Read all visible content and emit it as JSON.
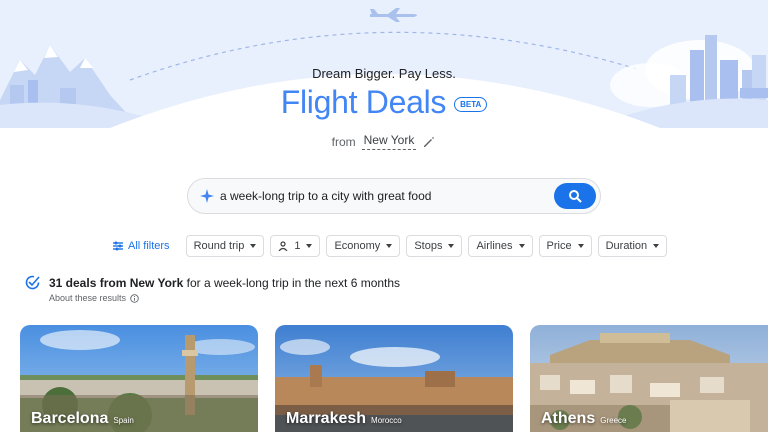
{
  "header": {
    "tagline": "Dream Bigger. Pay Less.",
    "title": "Flight Deals",
    "badge": "BETA"
  },
  "origin": {
    "prefix": "from",
    "city": "New York"
  },
  "search": {
    "query": "a week-long trip to a city with great food"
  },
  "filters": {
    "all_filters": "All filters",
    "chips": [
      "Round trip",
      "1",
      "Economy",
      "Stops",
      "Airlines",
      "Price",
      "Duration"
    ]
  },
  "results": {
    "count_text": "31 deals from New York",
    "rest_text": " for a week-long trip in the next 6 months",
    "about": "About these results"
  },
  "destinations": [
    {
      "city": "Barcelona",
      "country": "Spain"
    },
    {
      "city": "Marrakesh",
      "country": "Morocco"
    },
    {
      "city": "Athens",
      "country": "Greece"
    }
  ],
  "colors": {
    "brand_blue": "#4285f4",
    "accent": "#1a73e8",
    "hero_bg": "#e8f0fe"
  }
}
